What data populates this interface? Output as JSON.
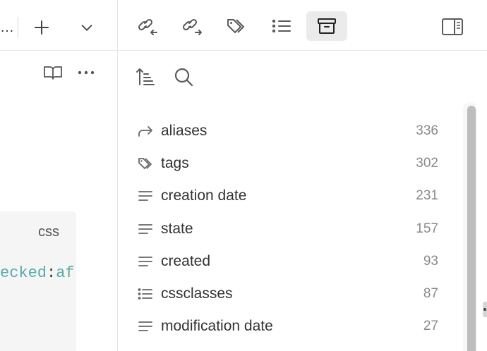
{
  "left_pane": {
    "tab_ellipsis": "…",
    "code_block": {
      "language": "css",
      "line_before": "ecked",
      "line_colon": ":",
      "line_after": "af"
    },
    "icons": {
      "new_tab": "plus-icon",
      "tab_list": "chevron-down-icon",
      "reading_view": "book-open-icon",
      "more_options": "more-horizontal-icon"
    }
  },
  "right_pane": {
    "toolbar": [
      {
        "name": "backlinks",
        "icon": "link-incoming-icon"
      },
      {
        "name": "outgoing-links",
        "icon": "link-outgoing-icon"
      },
      {
        "name": "tags",
        "icon": "tags-icon"
      },
      {
        "name": "outline",
        "icon": "list-icon"
      },
      {
        "name": "all-properties",
        "icon": "archive-icon",
        "active": true
      }
    ],
    "controls": {
      "sort": "sort-icon",
      "search": "search-icon"
    },
    "properties": [
      {
        "label": "aliases",
        "count": "336",
        "icon": "forward-arrow-icon"
      },
      {
        "label": "tags",
        "count": "302",
        "icon": "tags-icon"
      },
      {
        "label": "creation date",
        "count": "231",
        "icon": "text-lines-icon"
      },
      {
        "label": "state",
        "count": "157",
        "icon": "text-lines-icon"
      },
      {
        "label": "created",
        "count": "93",
        "icon": "text-lines-icon"
      },
      {
        "label": "cssclasses",
        "count": "87",
        "icon": "list-icon"
      },
      {
        "label": "modification date",
        "count": "27",
        "icon": "text-lines-icon"
      }
    ]
  },
  "colors": {
    "accent_active_bg": "#ebebeb",
    "code_text": "#5aa8a8",
    "muted_count": "#8a8a8a",
    "scrollbar_thumb": "#bdbdbd"
  }
}
